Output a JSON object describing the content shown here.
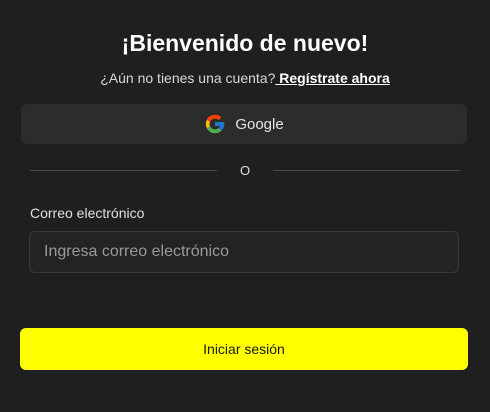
{
  "header": {
    "title": "¡Bienvenido de nuevo!",
    "signup_prompt": "¿Aún no tienes una cuenta?",
    "signup_link": " Regístrate ahora"
  },
  "social": {
    "google_label": "Google",
    "google_icon": "google-icon"
  },
  "divider": {
    "label": "O"
  },
  "form": {
    "email_label": "Correo electrónico",
    "email_placeholder": "Ingresa correo electrónico",
    "email_value": "",
    "submit_label": "Iniciar sesión"
  },
  "colors": {
    "background": "#1f1f1f",
    "accent": "#ffff00",
    "button_bg": "#2c2c2c"
  }
}
